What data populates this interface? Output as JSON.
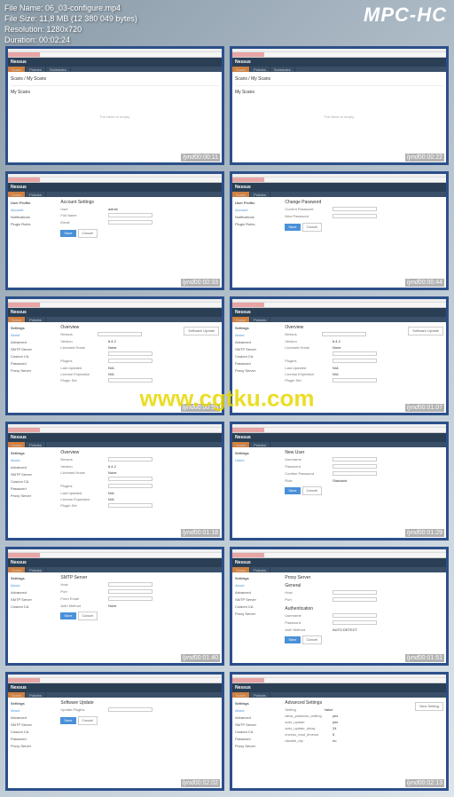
{
  "player": {
    "app_title": "MPC-HC",
    "file_name_label": "File Name:",
    "file_name": "06_03-configure.mp4",
    "file_size_label": "File Size:",
    "file_size": "11,8 MB (12 380 049 bytes)",
    "resolution_label": "Resolution:",
    "resolution": "1280x720",
    "duration_label": "Duration:",
    "duration": "00:02:24"
  },
  "watermark": "www.cgtku.com",
  "app": {
    "name": "Nessus",
    "brand": "lynd"
  },
  "thumbs": [
    {
      "timestamp": "00:00:11",
      "page_title": "Scans",
      "subtitle": "My Scans",
      "subnav": [
        "Scans",
        "Policies",
        "Schedules"
      ],
      "empty": "The folder is empty."
    },
    {
      "timestamp": "00:00:22",
      "page_title": "Scans",
      "subtitle": "My Scans",
      "subnav": [
        "Scans",
        "Policies",
        "Schedules"
      ],
      "empty": "The folder is empty."
    },
    {
      "timestamp": "00:00:33",
      "page_title": "User Profile",
      "section": "Account Settings",
      "sidebar": [
        "Account",
        "Notifications",
        "Plugin Rules"
      ],
      "rows": [
        {
          "label": "User",
          "value": "admin"
        },
        {
          "label": "Full Name",
          "value": ""
        },
        {
          "label": "Email",
          "value": ""
        }
      ],
      "btn": "Save"
    },
    {
      "timestamp": "00:00:44",
      "page_title": "User Profile",
      "section": "Change Password",
      "sidebar": [
        "Account",
        "Notifications",
        "Plugin Rules"
      ],
      "rows": [
        {
          "label": "Current Password",
          "value": ""
        },
        {
          "label": "New Password",
          "value": ""
        }
      ],
      "btn": "Save"
    },
    {
      "timestamp": "00:00:55",
      "page_title": "Settings",
      "section": "Overview",
      "sidebar": [
        "About",
        "Advanced",
        "SMTP Server",
        "Custom CA",
        "Password",
        "Proxy Server"
      ],
      "rows": [
        {
          "label": "Nessus",
          "value": ""
        },
        {
          "label": "Version",
          "value": "6.4.2"
        },
        {
          "label": "Licensed Hosts",
          "value": "None"
        },
        {
          "label": "",
          "value": ""
        },
        {
          "label": "Plugins",
          "value": ""
        },
        {
          "label": "Last Updated",
          "value": "N/A"
        },
        {
          "label": "License Expiration",
          "value": "N/A"
        },
        {
          "label": "Plugin Set",
          "value": ""
        }
      ],
      "btn_right": "Software Update"
    },
    {
      "timestamp": "00:01:07",
      "page_title": "Settings",
      "section": "Overview",
      "sidebar": [
        "About",
        "Advanced",
        "SMTP Server",
        "Custom CA",
        "Password",
        "Proxy Server"
      ],
      "rows": [
        {
          "label": "Nessus",
          "value": ""
        },
        {
          "label": "Version",
          "value": "6.4.2"
        },
        {
          "label": "Licensed Hosts",
          "value": "None"
        },
        {
          "label": "",
          "value": ""
        },
        {
          "label": "Plugins",
          "value": ""
        },
        {
          "label": "Last Updated",
          "value": "N/A"
        },
        {
          "label": "License Expiration",
          "value": "N/A"
        },
        {
          "label": "Plugin Set",
          "value": ""
        }
      ],
      "btn_right": "Software Update"
    },
    {
      "timestamp": "00:01:18",
      "page_title": "Settings",
      "section": "Overview",
      "sidebar": [
        "About",
        "Advanced",
        "SMTP Server",
        "Custom CA",
        "Password",
        "Proxy Server"
      ],
      "rows": [
        {
          "label": "Nessus",
          "value": ""
        },
        {
          "label": "Version",
          "value": "6.4.2"
        },
        {
          "label": "Licensed Hosts",
          "value": "None"
        },
        {
          "label": "",
          "value": ""
        },
        {
          "label": "Plugins",
          "value": ""
        },
        {
          "label": "Last Updated",
          "value": "N/A"
        },
        {
          "label": "License Expiration",
          "value": "N/A"
        },
        {
          "label": "Plugin Set",
          "value": ""
        }
      ]
    },
    {
      "timestamp": "00:01:29",
      "page_title": "Settings",
      "section": "New User",
      "sidebar": [
        "Users"
      ],
      "rows": [
        {
          "label": "Username",
          "value": ""
        },
        {
          "label": "Password",
          "value": ""
        },
        {
          "label": "Confirm Password",
          "value": ""
        },
        {
          "label": "Role",
          "value": "Standard"
        }
      ],
      "btn": "Save"
    },
    {
      "timestamp": "00:01:40",
      "page_title": "Settings",
      "section": "SMTP Server",
      "sidebar": [
        "About",
        "Advanced",
        "SMTP Server",
        "Custom CA"
      ],
      "rows": [
        {
          "label": "Host",
          "value": ""
        },
        {
          "label": "Port",
          "value": ""
        },
        {
          "label": "From Email",
          "value": ""
        },
        {
          "label": "Auth Method",
          "value": "None"
        }
      ],
      "btn": "Save"
    },
    {
      "timestamp": "00:01:51",
      "page_title": "Settings",
      "section": "Proxy Server",
      "sidebar": [
        "About",
        "Advanced",
        "SMTP Server",
        "Custom CA",
        "Proxy Server"
      ],
      "groups": [
        {
          "name": "General",
          "rows": [
            {
              "label": "Host",
              "value": ""
            },
            {
              "label": "Port",
              "value": ""
            }
          ]
        },
        {
          "name": "Authentication",
          "rows": [
            {
              "label": "Username",
              "value": ""
            },
            {
              "label": "Password",
              "value": ""
            },
            {
              "label": "Auth Method",
              "value": "AUTO DETECT"
            }
          ]
        }
      ],
      "btn": "Save"
    },
    {
      "timestamp": "00:02:02",
      "page_title": "Settings",
      "section": "Software Update",
      "sidebar": [
        "About",
        "Advanced",
        "SMTP Server",
        "Custom CA",
        "Password",
        "Proxy Server"
      ],
      "rows": [
        {
          "label": "Update Plugins",
          "value": ""
        }
      ],
      "btn": "Save"
    },
    {
      "timestamp": "00:02:13",
      "page_title": "Settings",
      "section": "Advanced Settings",
      "sidebar": [
        "About",
        "Advanced",
        "SMTP Server",
        "Custom CA",
        "Password",
        "Proxy Server"
      ],
      "rows": [
        {
          "label": "Setting",
          "value": "Value"
        },
        {
          "label": "allow_postscan_editing",
          "value": "yes"
        },
        {
          "label": "auto_update",
          "value": "yes"
        },
        {
          "label": "auto_update_delay",
          "value": "24"
        },
        {
          "label": "checks_read_timeout",
          "value": "5"
        },
        {
          "label": "disable_ntp",
          "value": "no"
        }
      ],
      "btn_right": "New Setting"
    }
  ]
}
